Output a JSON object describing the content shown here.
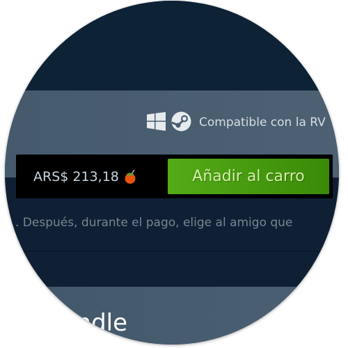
{
  "platforms": {
    "icons": [
      "windows-icon",
      "steamvr-icon"
    ],
    "compat_text": "Compatible con la RV"
  },
  "purchase": {
    "price": "ARS$ 213,18",
    "currency_icon": "mate-icon",
    "add_to_cart_label": "Añadir al carro",
    "button_color": "#4c9f12"
  },
  "gift_text": ". Después, durante el pago, elige al amigo que",
  "bundle_heading": "undle"
}
